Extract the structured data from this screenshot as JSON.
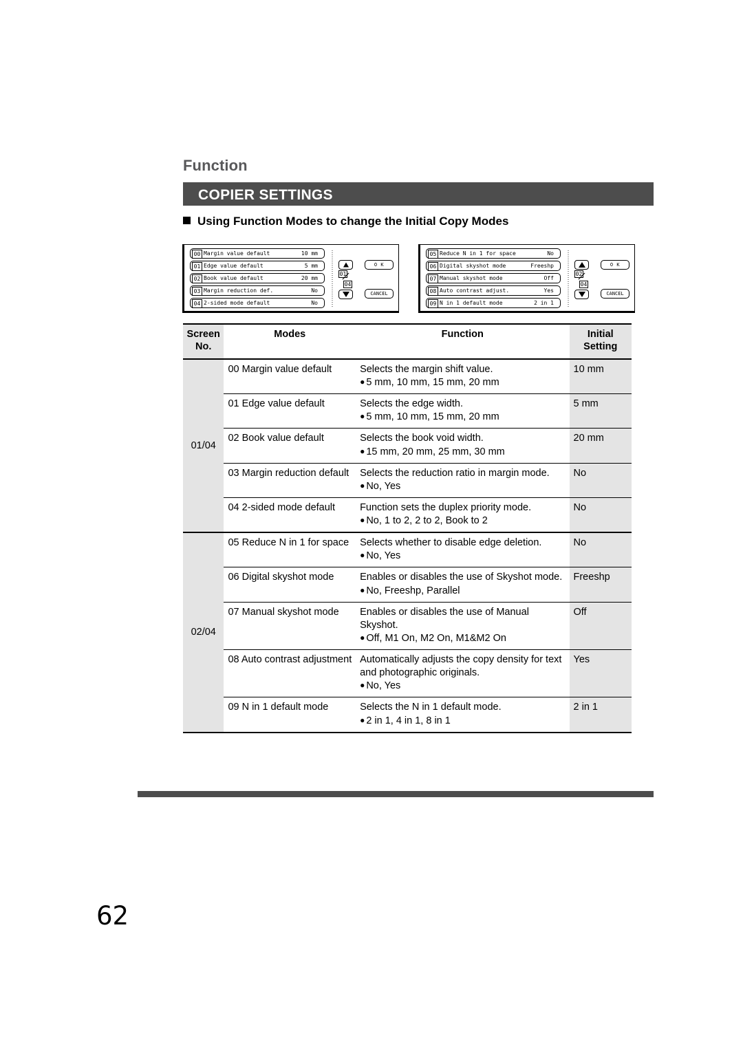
{
  "page": {
    "running_head": "Function",
    "section_title": "COPIER SETTINGS",
    "subheading": "Using Function Modes to change the Initial Copy Modes",
    "folio": "62",
    "colors": {
      "bar": "#4d4d4d",
      "header_shade": "#e4e4e4",
      "running_head": "#58585a"
    }
  },
  "lcd_panels": [
    {
      "id": "panel-a",
      "page_indicator_top": "01",
      "page_indicator_bottom": "04",
      "up_arrow": "hollow",
      "down_arrow": "solid",
      "ok_label": "O K",
      "cancel_label": "CANCEL",
      "rows": [
        {
          "num": "00",
          "label": "Margin value default",
          "value": "10 mm"
        },
        {
          "num": "01",
          "label": "Edge value default",
          "value": "5 mm"
        },
        {
          "num": "02",
          "label": "Book value default",
          "value": "20 mm"
        },
        {
          "num": "03",
          "label": "Margin reduction def.",
          "value": "No"
        },
        {
          "num": "04",
          "label": "2-sided mode default",
          "value": "No"
        }
      ]
    },
    {
      "id": "panel-b",
      "page_indicator_top": "02",
      "page_indicator_bottom": "04",
      "up_arrow": "solid",
      "down_arrow": "solid",
      "ok_label": "O K",
      "cancel_label": "CANCEL",
      "rows": [
        {
          "num": "05",
          "label": "Reduce N in 1 for space",
          "value": "No"
        },
        {
          "num": "06",
          "label": "Digital skyshot mode",
          "value": "Freeshp"
        },
        {
          "num": "07",
          "label": "Manual skyshot mode",
          "value": "Off"
        },
        {
          "num": "08",
          "label": "Auto contrast adjust.",
          "value": "Yes"
        },
        {
          "num": "09",
          "label": "N in 1 default mode",
          "value": "2 in 1"
        }
      ]
    }
  ],
  "table": {
    "headers": {
      "screen_no_line1": "Screen",
      "screen_no_line2": "No.",
      "modes": "Modes",
      "function": "Function",
      "initial_line1": "Initial",
      "initial_line2": "Setting"
    },
    "groups": [
      {
        "screen_no": "01/04",
        "rows": [
          {
            "mode": "00 Margin value default",
            "function": "Selects the margin shift value.",
            "function_line2": "",
            "options": "5 mm, 10 mm, 15 mm, 20 mm",
            "initial": "10 mm"
          },
          {
            "mode": "01 Edge value default",
            "function": "Selects the edge width.",
            "function_line2": "",
            "options": "5 mm, 10 mm, 15 mm, 20 mm",
            "initial": "5 mm"
          },
          {
            "mode": "02 Book value default",
            "function": "Selects the book void width.",
            "function_line2": "",
            "options": "15 mm, 20 mm, 25 mm, 30 mm",
            "initial": "20 mm"
          },
          {
            "mode": "03 Margin reduction default",
            "function": "Selects the reduction ratio in margin mode.",
            "function_line2": "",
            "options": "No, Yes",
            "initial": "No"
          },
          {
            "mode": "04 2-sided mode default",
            "function": "Function sets the duplex priority mode.",
            "function_line2": "",
            "options": "No, 1 to 2, 2 to 2, Book to 2",
            "initial": "No"
          }
        ]
      },
      {
        "screen_no": "02/04",
        "rows": [
          {
            "mode": "05 Reduce N in 1 for space",
            "function": "Selects whether to disable edge deletion.",
            "function_line2": "",
            "options": "No, Yes",
            "initial": "No"
          },
          {
            "mode": "06 Digital skyshot mode",
            "function": "Enables or disables the use of Skyshot mode.",
            "function_line2": "",
            "options": "No, Freeshp, Parallel",
            "initial": "Freeshp"
          },
          {
            "mode": "07 Manual skyshot mode",
            "function": "Enables or disables the use of Manual",
            "function_line2": "Skyshot.",
            "options": "Off, M1 On, M2 On, M1&M2 On",
            "initial": "Off"
          },
          {
            "mode": "08 Auto contrast adjustment",
            "function": "Automatically adjusts the copy density for text",
            "function_line2": "and photographic originals.",
            "options": "No, Yes",
            "initial": "Yes"
          },
          {
            "mode": "09 N in 1 default mode",
            "function": "Selects the N in 1 default mode.",
            "function_line2": "",
            "options": "2 in 1, 4 in 1, 8 in 1",
            "initial": "2 in 1"
          }
        ]
      }
    ]
  }
}
